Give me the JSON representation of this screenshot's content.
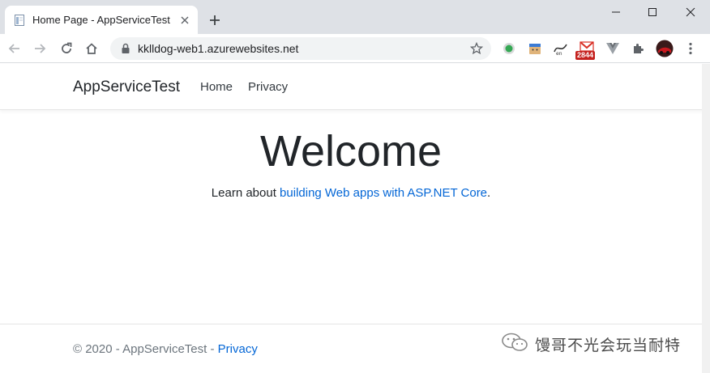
{
  "browser": {
    "tab_title": "Home Page - AppServiceTest",
    "url": "kklldog-web1.azurewebsites.net",
    "extension_badge": "2844"
  },
  "site": {
    "brand": "AppServiceTest",
    "nav": [
      "Home",
      "Privacy"
    ],
    "welcome": "Welcome",
    "learn_prefix": "Learn about ",
    "learn_link": "building Web apps with ASP.NET Core",
    "learn_suffix": ".",
    "footer_prefix": "© 2020 - AppServiceTest - ",
    "footer_link": "Privacy"
  },
  "watermark": "馒哥不光会玩当耐特",
  "colors": {
    "link": "#0366d6",
    "chrome_bg": "#dee1e6",
    "badge": "#c5221f"
  }
}
